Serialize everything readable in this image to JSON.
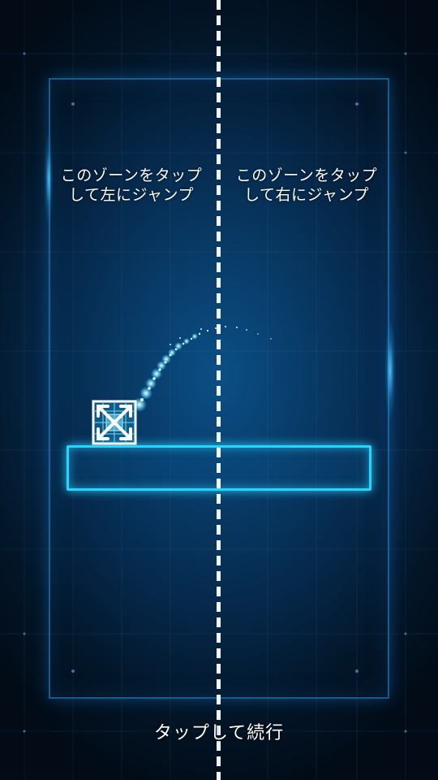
{
  "game": {
    "left_zone_hint": "このゾーンをタップして左にジャンプ",
    "right_zone_hint": "このゾーンをタップして右にジャンプ",
    "continue_prompt": "タップして続行"
  },
  "colors": {
    "neon_cyan": "#27d4ff",
    "background_deep": "#031527",
    "background_glow": "#0b4f86",
    "divider": "#ffffff"
  },
  "icons": {
    "player": "expand-arrows-square-icon",
    "divider": "dashed-center-line"
  }
}
